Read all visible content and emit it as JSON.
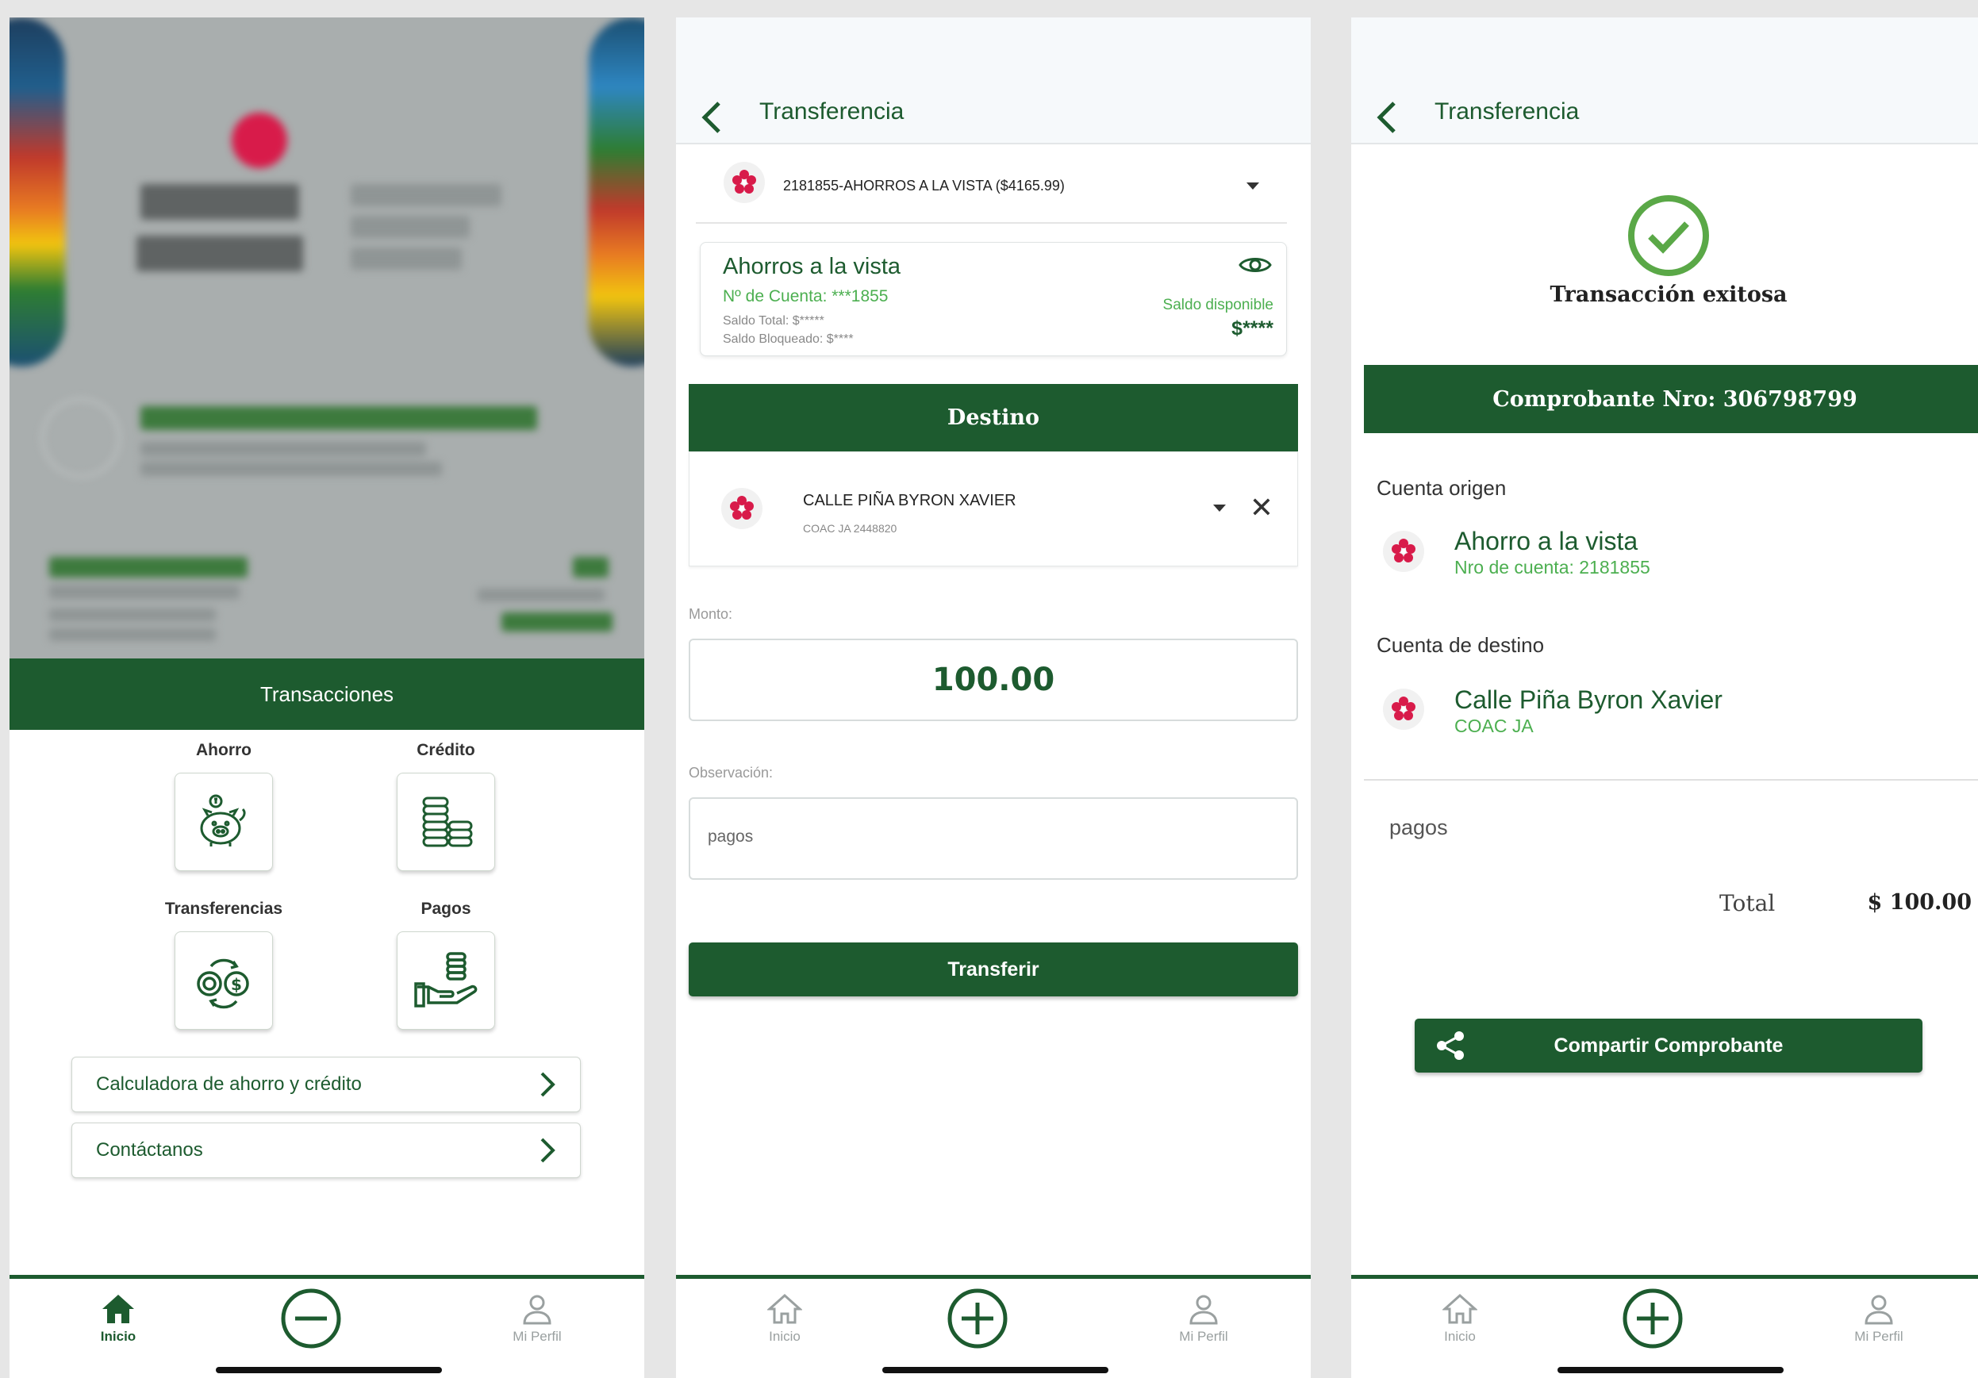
{
  "screen1": {
    "section_title": "Transacciones",
    "tiles": [
      {
        "label": "Ahorro",
        "icon": "piggy-bank-icon"
      },
      {
        "label": "Crédito",
        "icon": "coin-stacks-icon"
      },
      {
        "label": "Transferencias",
        "icon": "coin-exchange-icon"
      },
      {
        "label": "Pagos",
        "icon": "hand-coins-icon"
      }
    ],
    "links": [
      "Calculadora de ahorro y crédito",
      "Contáctanos"
    ],
    "tabs": {
      "home": "Inicio",
      "profile": "Mi Perfil"
    }
  },
  "screen2": {
    "title": "Transferencia",
    "source_account": "2181855-AHORROS A LA VISTA ($4165.99)",
    "card": {
      "name": "Ahorros a la vista",
      "number": "Nº de Cuenta: ***1855",
      "total": "Saldo Total: $*****",
      "blocked": "Saldo Bloqueado: $****",
      "available_label": "Saldo disponible",
      "available_value": "$****"
    },
    "destination_header": "Destino",
    "destination": {
      "name": "CALLE PIÑA BYRON XAVIER",
      "sub": "COAC JA  2448820"
    },
    "amount_label": "Monto:",
    "amount": "100.00",
    "obs_label": "Observación:",
    "obs_value": "pagos",
    "submit": "Transferir",
    "tabs": {
      "home": "Inicio",
      "profile": "Mi Perfil"
    }
  },
  "screen3": {
    "title": "Transferencia",
    "status": "Transacción exitosa",
    "voucher": "Comprobante Nro: 306798799",
    "origin_label": "Cuenta origen",
    "origin_name": "Ahorro a la vista",
    "origin_number": "Nro de cuenta: 2181855",
    "dest_label": "Cuenta de destino",
    "dest_name": "Calle Piña Byron Xavier",
    "dest_bank": "COAC JA",
    "note": "pagos",
    "total_label": "Total",
    "total_value": "$ 100.00",
    "share": "Compartir Comprobante",
    "tabs": {
      "home": "Inicio",
      "profile": "Mi Perfil"
    }
  },
  "colors": {
    "primary": "#1d5b2f",
    "accent": "#4caf50",
    "brand_flower": "#d81b4a"
  }
}
